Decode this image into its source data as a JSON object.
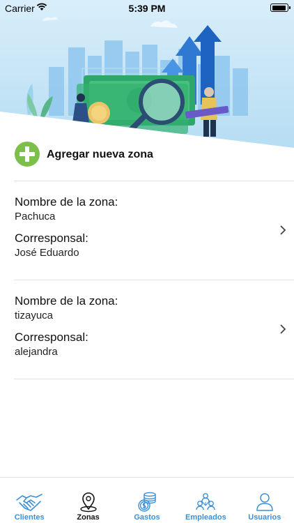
{
  "status_bar": {
    "carrier": "Carrier",
    "time": "5:39 PM"
  },
  "add_zone": {
    "label": "Agregar nueva zona",
    "accent": "#7cc04b"
  },
  "zones": [
    {
      "name_label": "Nombre de la zona:",
      "name": "Pachuca",
      "corresponsal_label": "Corresponsal:",
      "corresponsal": "José Eduardo"
    },
    {
      "name_label": "Nombre de la zona:",
      "name": "tizayuca",
      "corresponsal_label": "Corresponsal:",
      "corresponsal": "alejandra"
    }
  ],
  "tab_bar": {
    "items": [
      {
        "label": "Clientes",
        "icon": "handshake-icon"
      },
      {
        "label": "Zonas",
        "icon": "map-pin-icon",
        "active": true
      },
      {
        "label": "Gastos",
        "icon": "coins-icon"
      },
      {
        "label": "Empleados",
        "icon": "group-icon"
      },
      {
        "label": "Usuarios",
        "icon": "user-icon"
      }
    ],
    "active_color": "#111111",
    "inactive_color": "#3b8fd6"
  }
}
